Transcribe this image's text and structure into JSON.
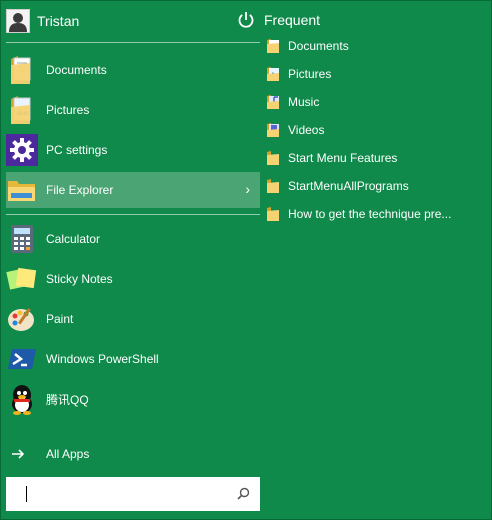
{
  "user": {
    "name": "Tristan"
  },
  "pinned": [
    {
      "label": "Documents",
      "icon": "documents-folder-icon"
    },
    {
      "label": "Pictures",
      "icon": "pictures-folder-icon"
    },
    {
      "label": "PC settings",
      "icon": "gear-icon"
    },
    {
      "label": "File Explorer",
      "icon": "file-explorer-icon",
      "active": true,
      "submenu_indicator": "›"
    }
  ],
  "apps": [
    {
      "label": "Calculator",
      "icon": "calculator-icon"
    },
    {
      "label": "Sticky Notes",
      "icon": "sticky-notes-icon"
    },
    {
      "label": "Paint",
      "icon": "paint-palette-icon"
    },
    {
      "label": "Windows PowerShell",
      "icon": "powershell-icon"
    },
    {
      "label": "腾讯QQ",
      "icon": "qq-penguin-icon"
    }
  ],
  "all_apps": {
    "label": "All Apps",
    "icon": "arrow-right-icon"
  },
  "search": {
    "value": "",
    "placeholder": ""
  },
  "frequent": {
    "title": "Frequent",
    "items": [
      {
        "label": "Documents",
        "icon": "documents-folder-icon"
      },
      {
        "label": "Pictures",
        "icon": "pictures-folder-icon"
      },
      {
        "label": "Music",
        "icon": "music-folder-icon"
      },
      {
        "label": "Videos",
        "icon": "videos-folder-icon"
      },
      {
        "label": "Start Menu Features",
        "icon": "folder-icon"
      },
      {
        "label": "StartMenuAllPrograms",
        "icon": "folder-icon"
      },
      {
        "label": "How to get the technique pre...",
        "icon": "folder-icon"
      }
    ]
  },
  "colors": {
    "background": "#0f8a4b",
    "active_item": "#4aa474",
    "text": "#ffffff"
  }
}
